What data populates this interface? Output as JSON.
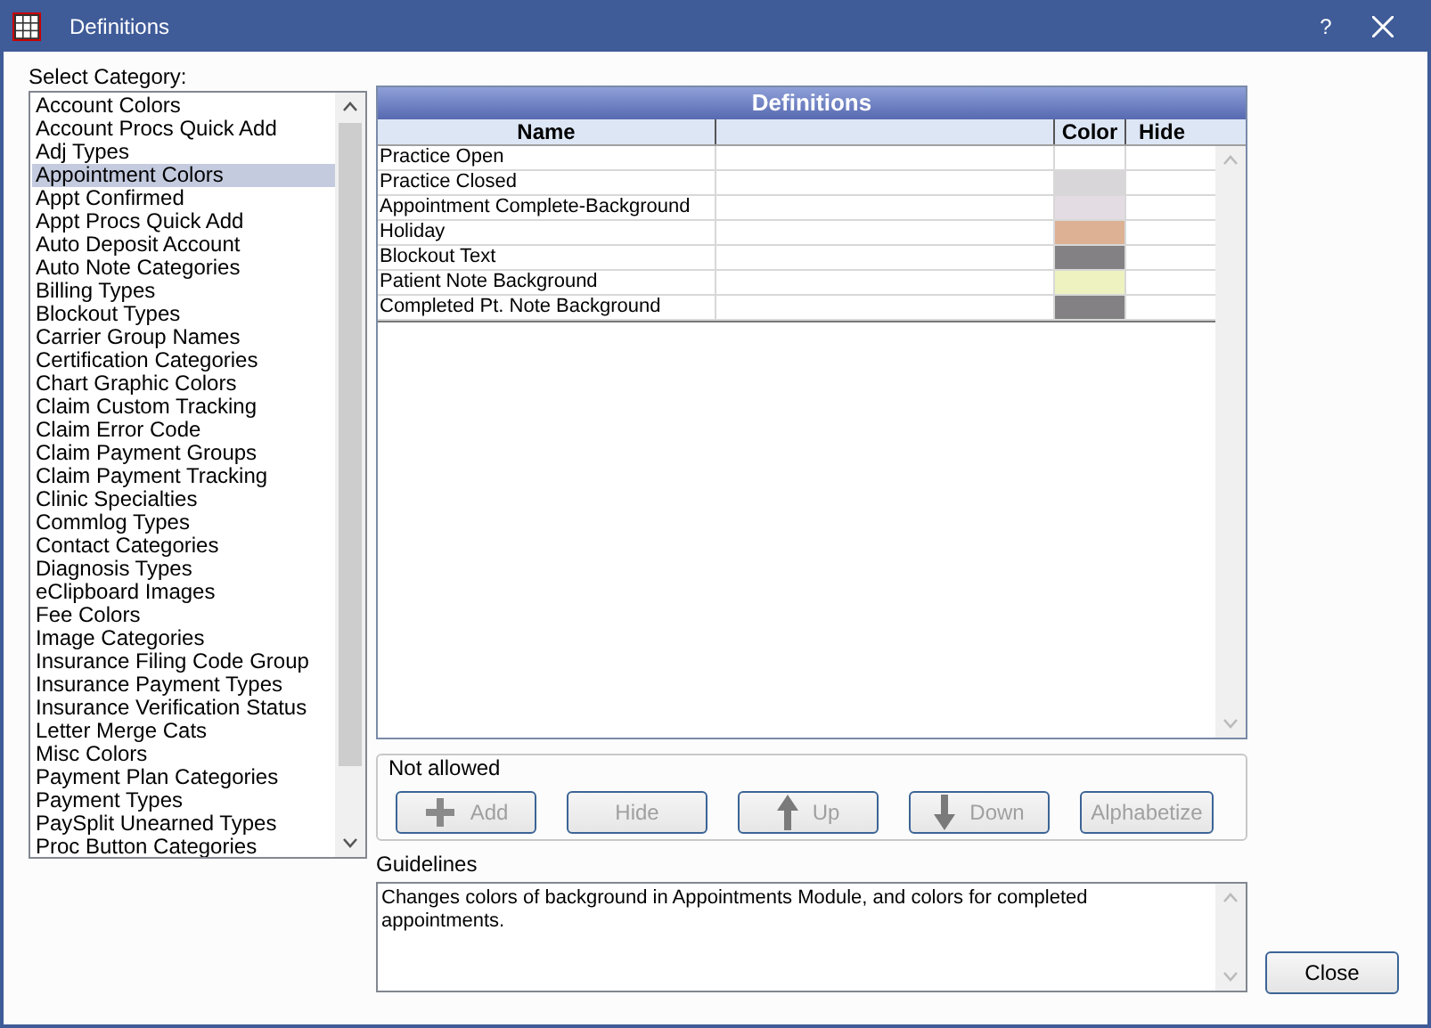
{
  "window": {
    "title": "Definitions",
    "help": "?"
  },
  "category_label": "Select Category:",
  "categories": [
    {
      "label": "Account Colors",
      "selected": false
    },
    {
      "label": "Account Procs Quick Add",
      "selected": false
    },
    {
      "label": "Adj Types",
      "selected": false
    },
    {
      "label": "Appointment Colors",
      "selected": true
    },
    {
      "label": "Appt Confirmed",
      "selected": false
    },
    {
      "label": "Appt Procs Quick Add",
      "selected": false
    },
    {
      "label": "Auto Deposit Account",
      "selected": false
    },
    {
      "label": "Auto Note Categories",
      "selected": false
    },
    {
      "label": "Billing Types",
      "selected": false
    },
    {
      "label": "Blockout Types",
      "selected": false
    },
    {
      "label": "Carrier Group Names",
      "selected": false
    },
    {
      "label": "Certification Categories",
      "selected": false
    },
    {
      "label": "Chart Graphic Colors",
      "selected": false
    },
    {
      "label": "Claim Custom Tracking",
      "selected": false
    },
    {
      "label": "Claim Error Code",
      "selected": false
    },
    {
      "label": "Claim Payment Groups",
      "selected": false
    },
    {
      "label": "Claim Payment Tracking",
      "selected": false
    },
    {
      "label": "Clinic Specialties",
      "selected": false
    },
    {
      "label": "Commlog Types",
      "selected": false
    },
    {
      "label": "Contact Categories",
      "selected": false
    },
    {
      "label": "Diagnosis Types",
      "selected": false
    },
    {
      "label": "eClipboard Images",
      "selected": false
    },
    {
      "label": "Fee Colors",
      "selected": false
    },
    {
      "label": "Image Categories",
      "selected": false
    },
    {
      "label": "Insurance Filing Code Group",
      "selected": false
    },
    {
      "label": "Insurance Payment Types",
      "selected": false
    },
    {
      "label": "Insurance Verification Status",
      "selected": false
    },
    {
      "label": "Letter Merge Cats",
      "selected": false
    },
    {
      "label": "Misc Colors",
      "selected": false
    },
    {
      "label": "Payment Plan Categories",
      "selected": false
    },
    {
      "label": "Payment Types",
      "selected": false
    },
    {
      "label": "PaySplit Unearned Types",
      "selected": false
    },
    {
      "label": "Proc Button Categories",
      "selected": false
    }
  ],
  "table": {
    "title": "Definitions",
    "columns": [
      "Name",
      "Color",
      "Hide"
    ],
    "rows": [
      {
        "name": "Practice Open",
        "color": "#ffffff"
      },
      {
        "name": "Practice Closed",
        "color": "#d8d6d8"
      },
      {
        "name": "Appointment Complete-Background",
        "color": "#e3dde3"
      },
      {
        "name": "Holiday",
        "color": "#dcb194"
      },
      {
        "name": "Blockout Text",
        "color": "#838183"
      },
      {
        "name": "Patient Note Background",
        "color": "#eef1c0"
      },
      {
        "name": "Completed Pt. Note Background",
        "color": "#838183"
      }
    ]
  },
  "actions": {
    "label": "Not allowed",
    "buttons": [
      {
        "label": "Add",
        "kind": "plus",
        "disabled": true
      },
      {
        "label": "Hide",
        "kind": "none",
        "disabled": true
      },
      {
        "label": "Up",
        "kind": "up",
        "disabled": true
      },
      {
        "label": "Down",
        "kind": "down",
        "disabled": true
      },
      {
        "label": "Alphabetize",
        "kind": "none",
        "disabled": true
      }
    ]
  },
  "guidelines": {
    "label": "Guidelines",
    "text": "Changes colors of background in Appointments Module, and colors for completed appointments."
  },
  "close_button": "Close"
}
